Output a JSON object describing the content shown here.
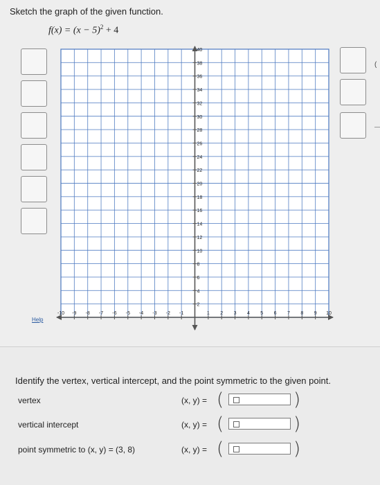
{
  "problem": {
    "prompt": "Sketch the graph of the given function.",
    "function_lhs": "f(x) = (x − 5)",
    "function_exp": "2",
    "function_rhs": " + 4"
  },
  "help_link": "Help",
  "right_edge_glyph": "(",
  "graph": {
    "x_min": -10,
    "x_max": 10,
    "y_min": 0,
    "y_max": 40,
    "x_ticks": [
      -10,
      -9,
      -8,
      -7,
      -6,
      -5,
      -4,
      -3,
      -2,
      -1,
      1,
      2,
      3,
      4,
      5,
      6,
      7,
      8,
      9,
      10
    ],
    "y_ticks": [
      2,
      4,
      6,
      8,
      10,
      12,
      14,
      16,
      18,
      20,
      22,
      24,
      26,
      28,
      30,
      32,
      34,
      36,
      38,
      40
    ],
    "grid_color": "#4b78c0",
    "axis_color": "#555555"
  },
  "questions": {
    "instruction": "Identify the vertex, vertical intercept, and the point symmetric to the given point.",
    "rows": [
      {
        "label": "vertex",
        "xy": "(x, y) =",
        "value": ""
      },
      {
        "label": "vertical intercept",
        "xy": "(x, y) =",
        "value": ""
      },
      {
        "label": "point symmetric to (x, y) = (3, 8)",
        "xy": "(x, y) =",
        "value": ""
      }
    ]
  }
}
